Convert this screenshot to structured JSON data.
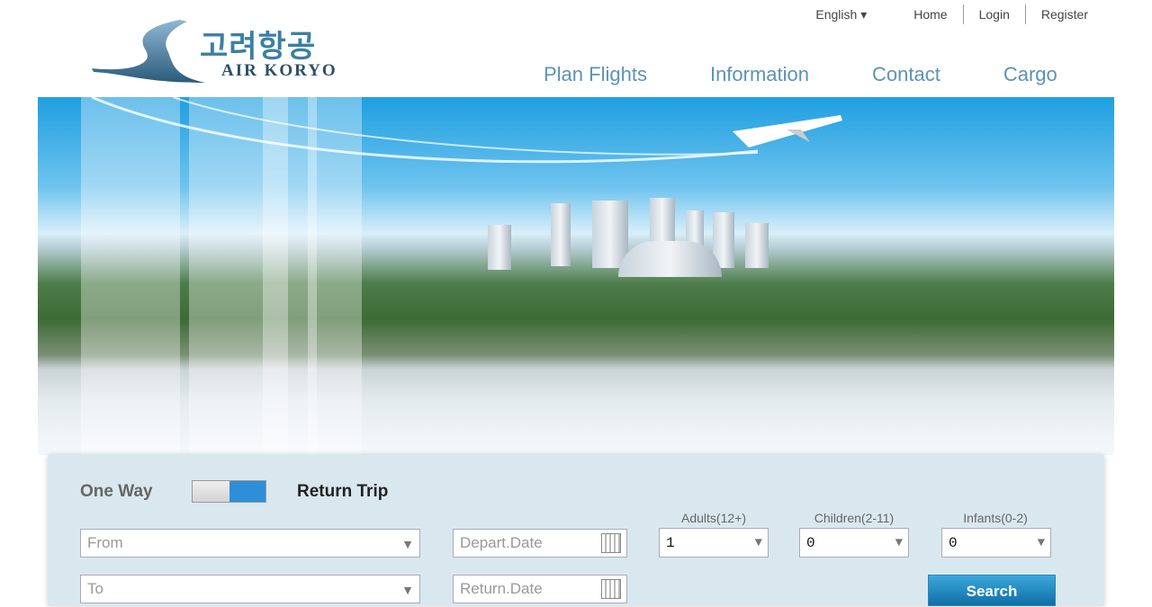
{
  "header": {
    "language": "English",
    "links": [
      "Home",
      "Login",
      "Register"
    ]
  },
  "logo": {
    "korean": "고려항공",
    "english": "AIR KORYO"
  },
  "nav": [
    "Plan Flights",
    "Information",
    "Contact",
    "Cargo"
  ],
  "booking": {
    "one_way": "One Way",
    "return_trip": "Return Trip",
    "trip_type": "Return Trip",
    "from_placeholder": "From",
    "to_placeholder": "To",
    "depart_placeholder": "Depart.Date",
    "return_placeholder": "Return.Date",
    "passengers": [
      {
        "label": "Adults(12+)",
        "value": "1"
      },
      {
        "label": "Children(2-11)",
        "value": "0"
      },
      {
        "label": "Infants(0-2)",
        "value": "0"
      }
    ],
    "search_label": "Search"
  },
  "colors": {
    "accent": "#2e8fd8",
    "nav": "#5c93b5",
    "panel": "#d9e8ee"
  }
}
